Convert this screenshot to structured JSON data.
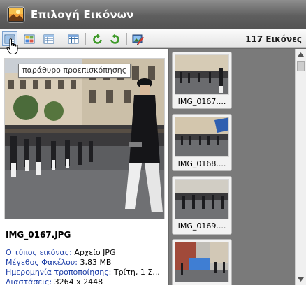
{
  "window": {
    "title": "Επιλογή Εικόνων"
  },
  "toolbar": {
    "image_count": "117 Εικόνες",
    "buttons": [
      {
        "name": "preview-view-button",
        "icon": "preview-layout-icon",
        "active": true
      },
      {
        "name": "thumbnails-view-button",
        "icon": "thumbnail-grid-icon"
      },
      {
        "name": "details-view-button",
        "icon": "details-list-icon"
      },
      {
        "name": "list-view-button",
        "icon": "table-list-icon"
      },
      {
        "name": "rotate-left-button",
        "icon": "rotate-left-icon"
      },
      {
        "name": "rotate-right-button",
        "icon": "rotate-right-icon"
      },
      {
        "name": "slideshow-button",
        "icon": "image-editor-icon"
      }
    ]
  },
  "tooltip": {
    "text": "παράθυρο προεπισκόπησης"
  },
  "preview": {
    "file_name": "IMG_0167.JPG",
    "info": [
      {
        "label": "Ο τύπος εικόνας:",
        "value": "Αρχείο JPG"
      },
      {
        "label": "Μέγεθος Φακέλου:",
        "value": "3,83 MB"
      },
      {
        "label": "Ημερομηνία τροποποίησης:",
        "value": "Τρίτη, 1 Σ..."
      },
      {
        "label": "Διαστάσεις:",
        "value": "3264 x 2448"
      }
    ]
  },
  "thumbnails": [
    {
      "caption": "IMG_0167...."
    },
    {
      "caption": "IMG_0168...."
    },
    {
      "caption": "IMG_0169...."
    },
    {
      "caption": ""
    }
  ],
  "colors": {
    "titlebar": "#5f5f5f",
    "accent_blue": "#1e3fa8",
    "thumbnail_panel": "#7a7a7a"
  }
}
